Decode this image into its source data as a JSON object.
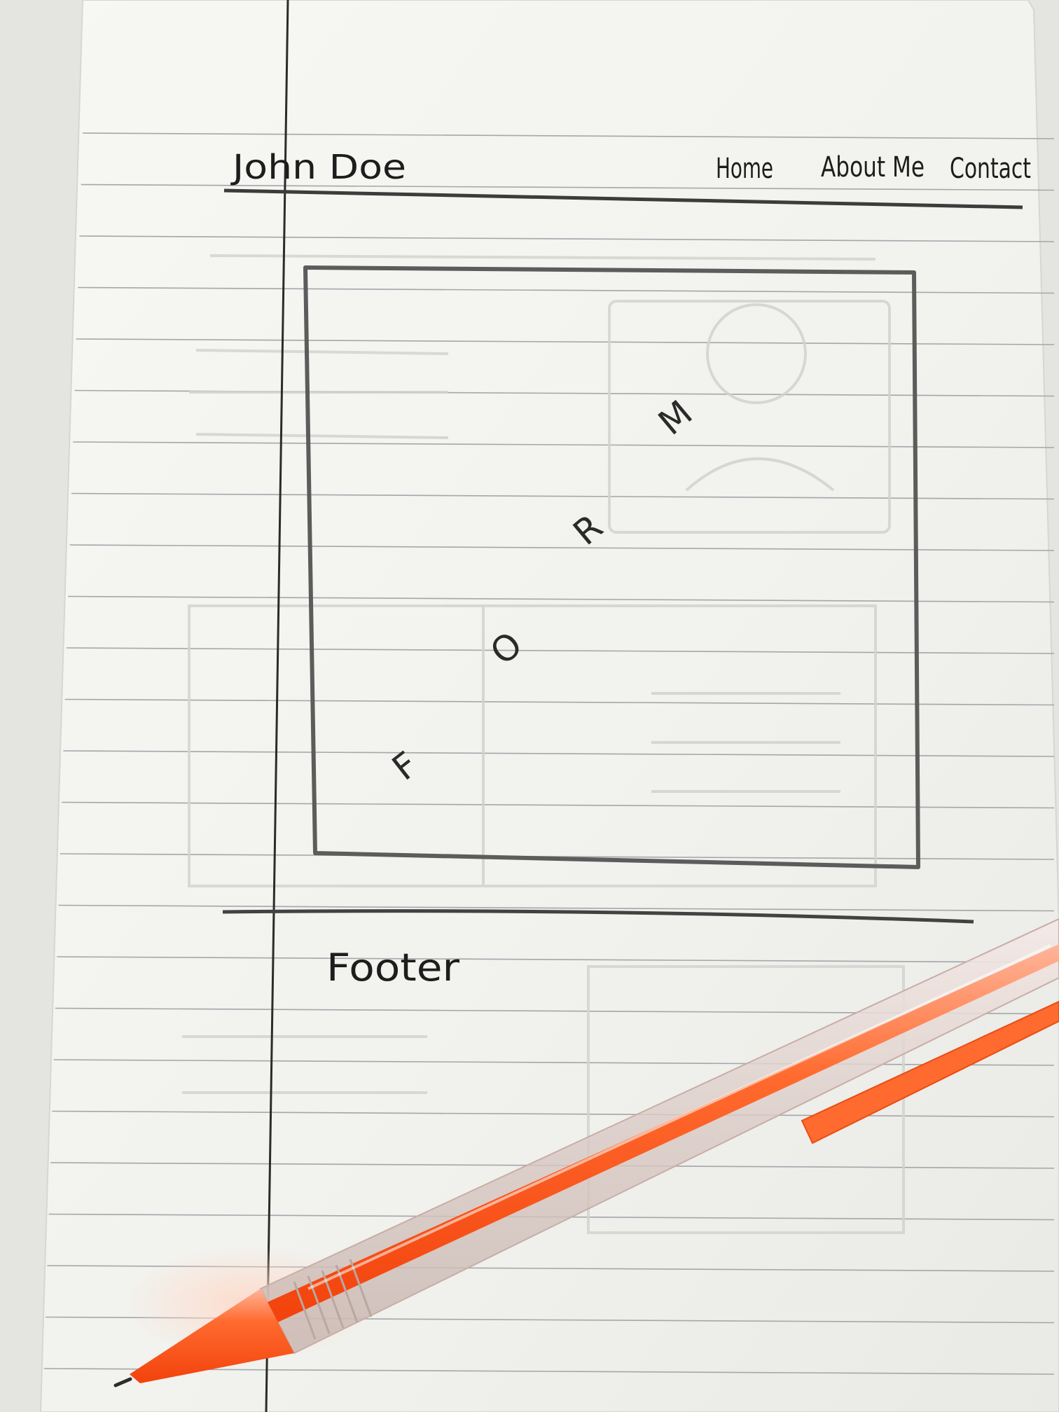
{
  "sketch": {
    "site_title": "John Doe",
    "nav": [
      "Home",
      "About Me",
      "Contact"
    ],
    "form_letters": [
      "F",
      "O",
      "R",
      "M"
    ],
    "footer": "Footer"
  },
  "colors": {
    "paper": "#f5f5f1",
    "ruled_line": "#9ea2a6",
    "pencil": "#4a4a4a",
    "pen_orange": "#ff5a1f"
  },
  "objects": {
    "pen": "orange-pen"
  }
}
